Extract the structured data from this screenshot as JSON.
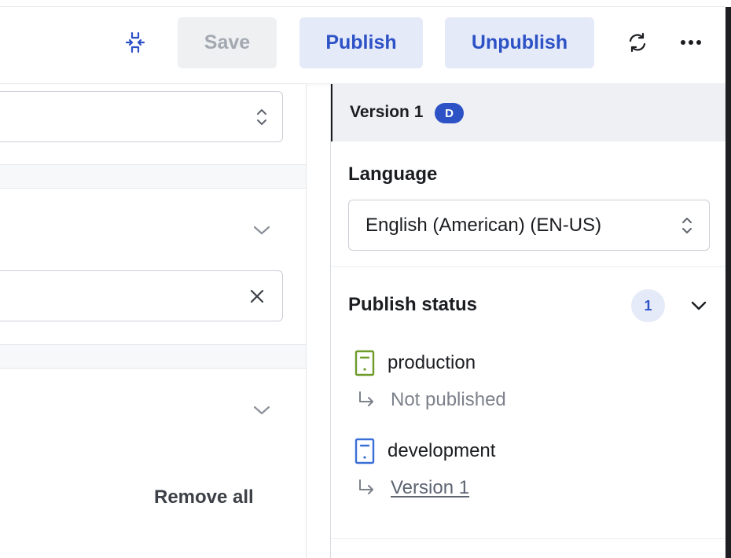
{
  "header": {
    "save_label": "Save",
    "publish_label": "Publish",
    "unpublish_label": "Unpublish",
    "icons": [
      "collapse-icon",
      "refresh-icon",
      "more-icon"
    ]
  },
  "left_panel": {
    "remove_all_label": "Remove all"
  },
  "right_panel": {
    "version_label": "Version 1",
    "version_badge": "D",
    "language_title": "Language",
    "language_value": "English (American) (EN-US)",
    "publish_status_title": "Publish status",
    "publish_status_count": "1",
    "environments": [
      {
        "name": "production",
        "status": "Not published",
        "status_is_link": false,
        "color": "#6e9b2a"
      },
      {
        "name": "development",
        "status": "Version 1",
        "status_is_link": true,
        "color": "#3a6fd8"
      }
    ]
  },
  "colors": {
    "accent": "#2d52c6",
    "accent_bg": "#e5eaf9",
    "disabled_bg": "#eef0f2",
    "disabled_text": "#a4a9b1"
  }
}
